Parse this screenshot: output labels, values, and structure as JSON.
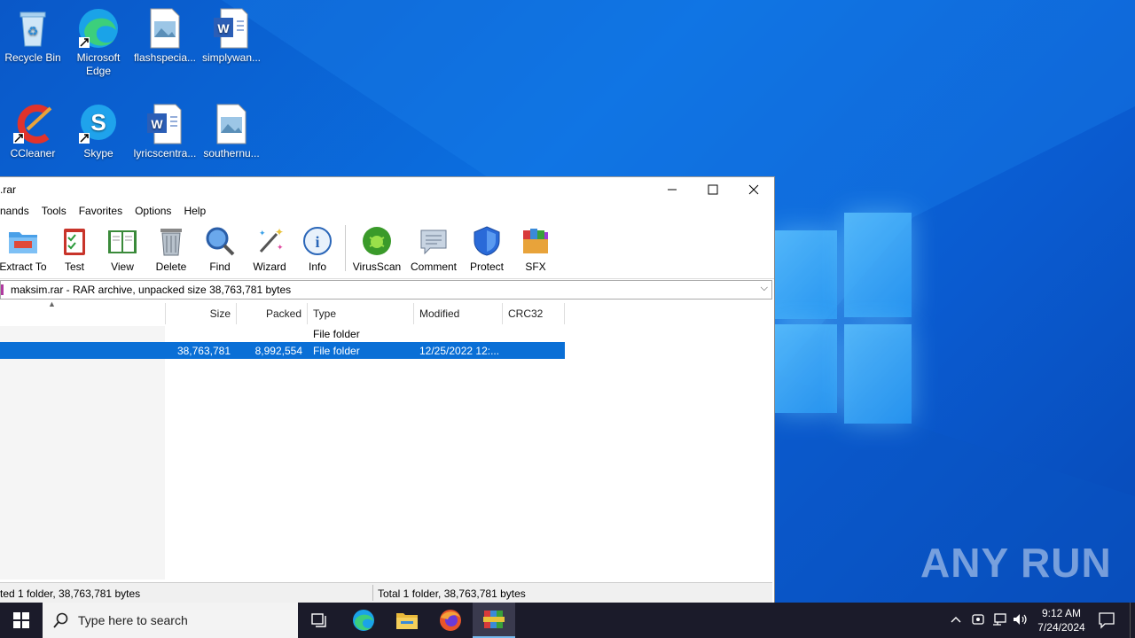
{
  "desktop": {
    "icons": [
      {
        "label": "Recycle Bin"
      },
      {
        "label": "Microsoft Edge"
      },
      {
        "label": "flashspecia..."
      },
      {
        "label": "simplywan..."
      },
      {
        "label": "CCleaner"
      },
      {
        "label": "Skype"
      },
      {
        "label": "lyricscentra..."
      },
      {
        "label": "southernu..."
      }
    ],
    "watermark": "ANY RUN"
  },
  "window": {
    "title": ".rar",
    "menu": [
      "nands",
      "Tools",
      "Favorites",
      "Options",
      "Help"
    ],
    "toolbar": [
      "Extract To",
      "Test",
      "View",
      "Delete",
      "Find",
      "Wizard",
      "Info",
      "VirusScan",
      "Comment",
      "Protect",
      "SFX"
    ],
    "address": "maksim.rar - RAR archive, unpacked size 38,763,781 bytes",
    "columns": [
      "Size",
      "Packed",
      "Type",
      "Modified",
      "CRC32"
    ],
    "rows": [
      {
        "size": "",
        "packed": "",
        "type": "File folder",
        "modified": "",
        "crc": ""
      },
      {
        "size": "38,763,781",
        "packed": "8,992,554",
        "type": "File folder",
        "modified": "12/25/2022 12:...",
        "crc": ""
      }
    ],
    "status_left": "ted 1 folder, 38,763,781 bytes",
    "status_right": "Total 1 folder, 38,763,781 bytes"
  },
  "taskbar": {
    "search_placeholder": "Type here to search",
    "time": "9:12 AM",
    "date": "7/24/2024"
  }
}
